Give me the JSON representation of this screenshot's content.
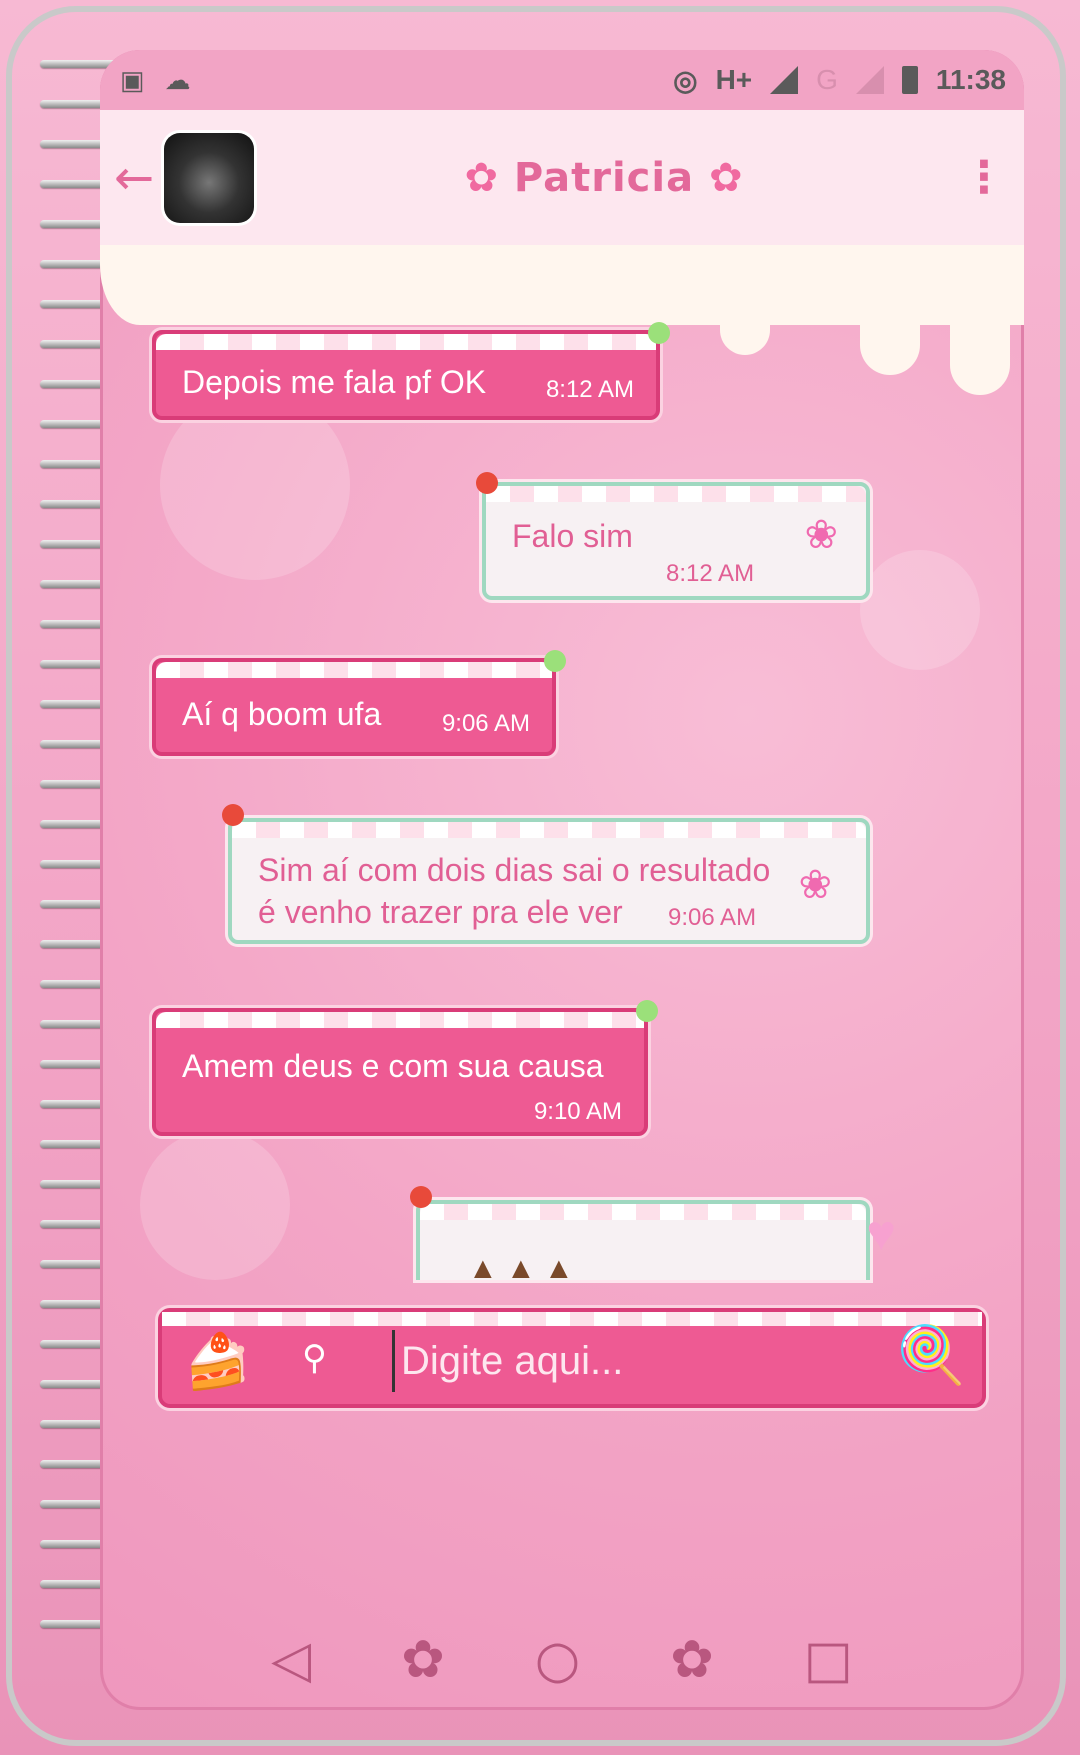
{
  "status_bar": {
    "network": "H+",
    "network2": "G",
    "time": "11:38"
  },
  "header": {
    "back_icon": "arrow-left",
    "contact_name": "Patricia",
    "menu_icon": "⋮"
  },
  "messages": [
    {
      "direction": "in",
      "text": "Depois me fala pf OK",
      "time": "8:12 AM"
    },
    {
      "direction": "out",
      "text": "Falo sim",
      "time": "8:12 AM"
    },
    {
      "direction": "in",
      "text": "Aí q boom ufa",
      "time": "9:06 AM"
    },
    {
      "direction": "out",
      "text_line1": "Sim aí com dois dias sai o resultado",
      "text_line2": "é venho trazer pra ele ver",
      "time": "9:06 AM"
    },
    {
      "direction": "in",
      "text": "Amem deus e com sua causa",
      "time": "9:10 AM"
    }
  ],
  "composer": {
    "placeholder": "Digite aqui..."
  },
  "colors": {
    "incoming_bubble": "#ee5a93",
    "outgoing_bubble": "#f7f1f3",
    "accent": "#e3699a"
  }
}
